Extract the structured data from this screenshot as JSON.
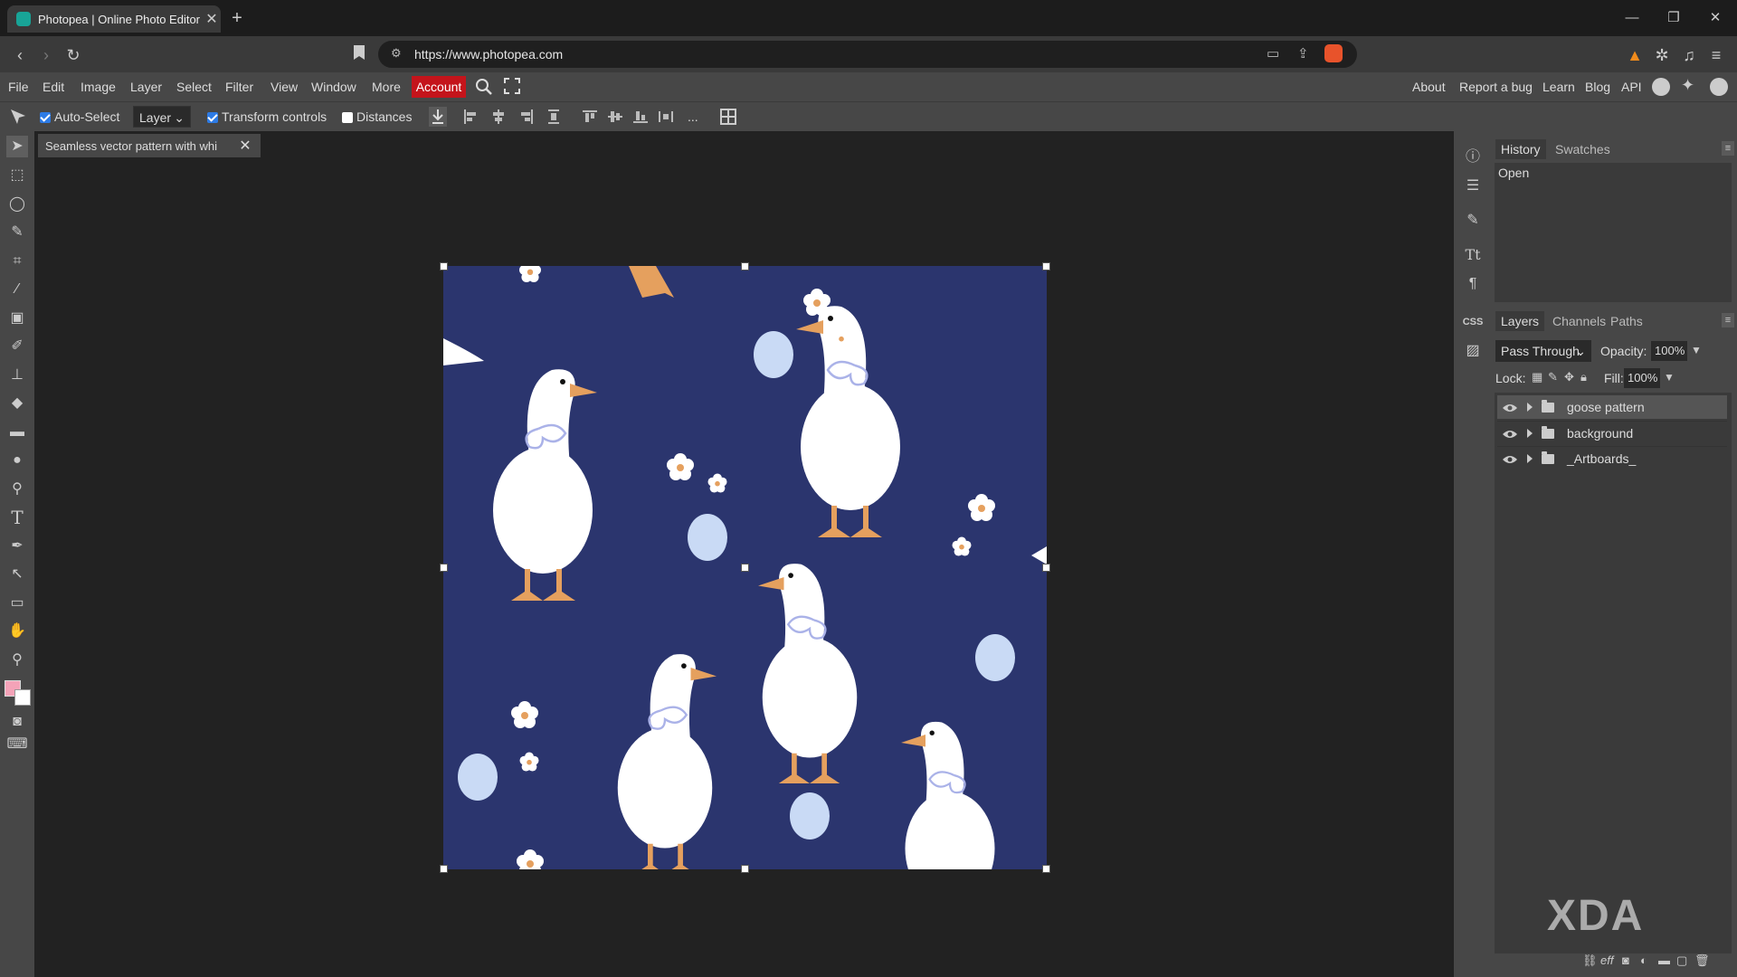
{
  "browser": {
    "tab_title": "Photopea | Online Photo Editor",
    "url": "https://www.photopea.com"
  },
  "menu": {
    "items": [
      "File",
      "Edit",
      "Image",
      "Layer",
      "Select",
      "Filter",
      "View",
      "Window",
      "More"
    ],
    "account": "Account",
    "right_links": [
      "About",
      "Report a bug",
      "Learn",
      "Blog",
      "API"
    ]
  },
  "options": {
    "auto_select": "Auto-Select",
    "auto_select_checked": true,
    "layer_select": "Layer",
    "transform_controls": "Transform controls",
    "transform_checked": true,
    "distances": "Distances",
    "distances_checked": false,
    "more": "..."
  },
  "document": {
    "tab_title": "Seamless vector pattern with whi"
  },
  "history_panel": {
    "tabs": [
      "History",
      "Swatches"
    ],
    "items": [
      "Open"
    ]
  },
  "layers_panel": {
    "tabs": [
      "Layers",
      "Channels",
      "Paths"
    ],
    "blend_mode": "Pass Through",
    "opacity_label": "Opacity:",
    "opacity_value": "100%",
    "lock_label": "Lock:",
    "fill_label": "Fill:",
    "fill_value": "100%",
    "layers": [
      {
        "name": "goose pattern",
        "selected": true
      },
      {
        "name": "background",
        "selected": false
      },
      {
        "name": "_Artboards_",
        "selected": false
      }
    ],
    "footer_eff": "eff"
  },
  "colors": {
    "foreground": "#f4a3b8",
    "background": "#ffffff",
    "canvas_bg": "#2b356e",
    "account_red": "#c4141b"
  },
  "watermark": "XDA"
}
